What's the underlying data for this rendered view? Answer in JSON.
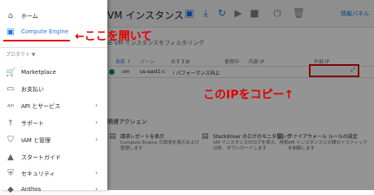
{
  "drawer": {
    "home": "ホーム",
    "compute_engine": "Compute Engine",
    "products_label": "プロダクト ▼",
    "items": [
      {
        "label": "Marketplace",
        "icon": "cart-icon",
        "glyph": "🛒"
      },
      {
        "label": "お支払い",
        "icon": "billing-icon",
        "glyph": "▭"
      },
      {
        "label": "API とサービス",
        "icon": "api-icon",
        "glyph": "API"
      },
      {
        "label": "サポート",
        "icon": "support-icon",
        "glyph": "†"
      },
      {
        "label": "IAM と管理",
        "icon": "shield-icon",
        "glyph": "⛉"
      },
      {
        "label": "スタートガイド",
        "icon": "graduation-icon",
        "glyph": "▲"
      },
      {
        "label": "セキュリティ",
        "icon": "security-icon",
        "glyph": "⛨"
      },
      {
        "label": "Anthos",
        "icon": "anthos-icon",
        "glyph": "◆"
      }
    ]
  },
  "main": {
    "title": "VM インスタンス",
    "help_link": "情報パネル",
    "filter_placeholder": "VM インスタンスをフィルタリング",
    "columns": [
      "名前 ↑",
      "ゾーン",
      "おすすめ",
      "使用中",
      "内部 IP",
      "外部 IP"
    ],
    "row": {
      "name": "vm",
      "zone": "us-east1-c",
      "recommendation": "! パフォーマンス向上"
    },
    "section_label": "関連アクション",
    "actions": [
      {
        "title": "請求レポートを表示",
        "desc": "Compute Engine の請求を表示および管理します",
        "icon": "billing-icon"
      },
      {
        "title": "Stackdriver のログのモニタリング",
        "desc": "VM インスタンスのログを表示、検索、分析、ダウンロードします",
        "icon": "logs-icon"
      },
      {
        "title": "ファイアウォール ルールの設定",
        "desc": "VM インスタンスとの間のトラフィックを制御します",
        "icon": "firewall-icon"
      }
    ]
  },
  "annotations": {
    "open_here": "←ここを開いて",
    "copy_ip": "このIPをコピー↑"
  },
  "colors": {
    "accent": "#1a73e8",
    "annotation_red": "#e00000",
    "status_green": "#1e8e3e"
  }
}
